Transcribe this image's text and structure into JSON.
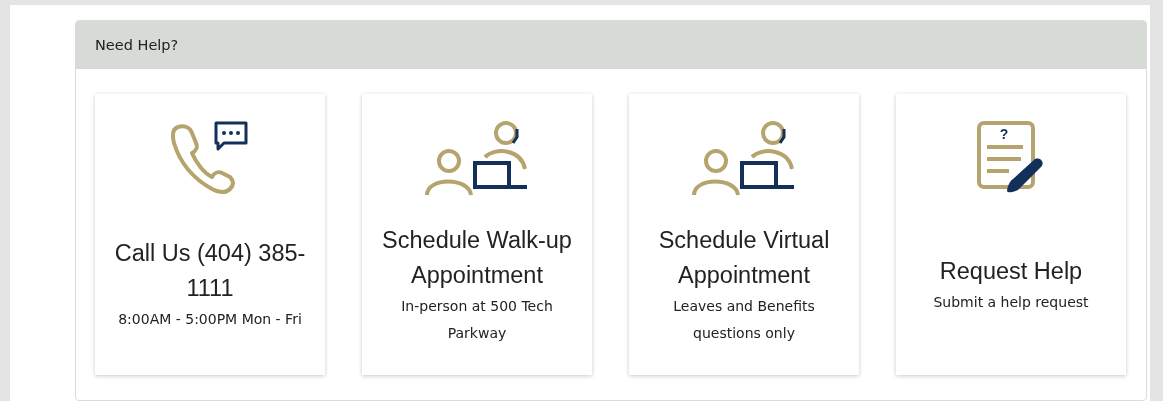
{
  "panel": {
    "title": "Need Help?"
  },
  "cards": [
    {
      "kind": "phone",
      "title": "Call Us (404) 385-1111",
      "subtitle": "8:00AM - 5:00PM Mon - Fri"
    },
    {
      "kind": "meeting",
      "title": "Schedule Walk-up Appointment",
      "subtitle": "In-person at 500 Tech Parkway"
    },
    {
      "kind": "meeting",
      "title": "Schedule Virtual Appointment",
      "subtitle": "Leaves and Benefits questions only"
    },
    {
      "kind": "form",
      "icon_text": "?",
      "title": "Request Help",
      "subtitle": "Submit a help request"
    }
  ]
}
